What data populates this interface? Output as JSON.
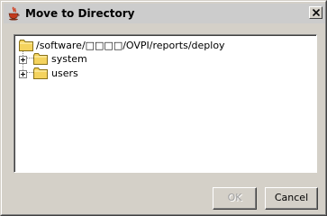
{
  "window": {
    "title": "Move to Directory",
    "title_icon": "java-cup-icon",
    "close_icon": "close-icon"
  },
  "tree": {
    "root": {
      "label": "/software/□□□□/OVPI/reports/deploy",
      "icon": "folder-icon"
    },
    "children": [
      {
        "label": "system",
        "icon": "folder-icon",
        "expander": "plus-icon"
      },
      {
        "label": "users",
        "icon": "folder-icon",
        "expander": "plus-icon"
      }
    ]
  },
  "buttons": {
    "ok_label": "OK",
    "ok_enabled": false,
    "cancel_label": "Cancel"
  },
  "colors": {
    "folder": "#f4d35e",
    "folder_outline": "#8a7218",
    "dialog_bg": "#d4d0c8",
    "titlebar_bg": "#cccccc"
  }
}
